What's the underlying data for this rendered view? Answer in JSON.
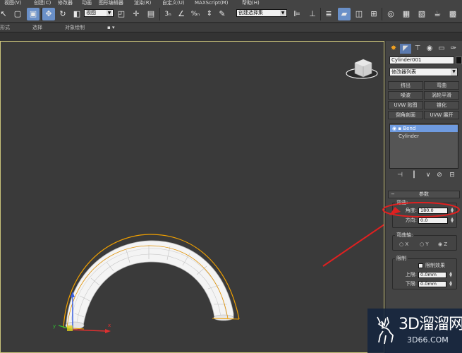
{
  "menu": {
    "items": [
      "视图(V)",
      "创建(C)",
      "修改器",
      "动画",
      "图形编辑器",
      "渲染(R)",
      "自定义(U)",
      "MAXScript(M)",
      "帮助(H)"
    ]
  },
  "toolbar": {
    "view_dropdown": "视图",
    "selection_set_dropdown": "创建选择集"
  },
  "ribbon": {
    "items": [
      "形式",
      "选择",
      "对象绘制"
    ]
  },
  "command_panel": {
    "object_name": "Cylinder001",
    "modifier_list": "修改器列表",
    "modifier_buttons": [
      "挤出",
      "弯曲",
      "噪波",
      "涡轮平滑",
      "UVW 贴图",
      "锥化",
      "倒角剖面",
      "UVW 展开"
    ],
    "stack_items": [
      {
        "label": "Bend",
        "selected": true
      },
      {
        "label": "Cylinder",
        "selected": false
      }
    ],
    "params_title": "参数",
    "bend_group": {
      "title": "弯曲:",
      "angle_label": "角度:",
      "angle_value": "180.0",
      "direction_label": "方向:",
      "direction_value": "0.0"
    },
    "axis_group": {
      "title": "弯曲轴:",
      "options": [
        "X",
        "Y",
        "Z"
      ],
      "selected": "Z"
    },
    "limit_group": {
      "title": "限制",
      "limit_effect_label": "限制效果",
      "upper_label": "上限:",
      "upper_value": "0.0mm",
      "lower_label": "下限:",
      "lower_value": "0.0mm"
    }
  },
  "watermark": {
    "big": "3D溜溜网",
    "small": "3D66.COM"
  },
  "colors": {
    "viewport_bg": "#3a3a3a",
    "selection_blue": "#6f9be0",
    "annotation_red": "#e02020",
    "gizmo_orange": "#f0a000"
  },
  "icons": [
    "select-icon",
    "region-select-icon",
    "move-icon",
    "rotate-icon",
    "scale-icon",
    "snap-icon",
    "angle-snap-icon",
    "percent-snap-icon",
    "mirror-icon",
    "align-icon",
    "layer-icon",
    "render-icon",
    "viewcube-icon"
  ]
}
